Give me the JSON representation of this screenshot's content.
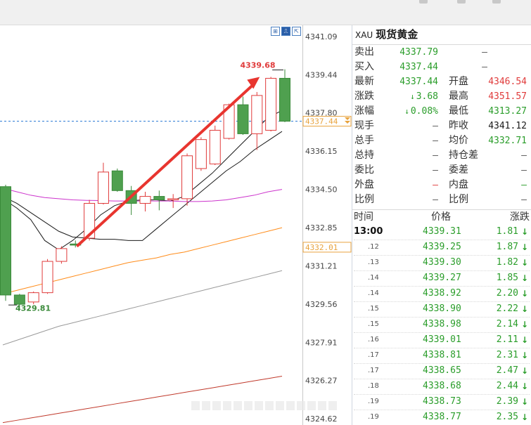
{
  "chart_data": {
    "type": "candlestick",
    "y_axis": {
      "range": [
        4323.94,
        4341.6
      ],
      "ticks": [
        "4341.09",
        "4339.44",
        "4337.80",
        "4336.15",
        "4334.50",
        "4332.85",
        "4331.21",
        "4329.56",
        "4327.91",
        "4326.27",
        "4324.62"
      ],
      "tick_values": [
        4341.09,
        4339.44,
        4337.8,
        4336.15,
        4334.5,
        4332.85,
        4331.21,
        4329.56,
        4327.91,
        4326.27,
        4324.62
      ]
    },
    "candles": [
      {
        "o": 4334.62,
        "c": 4329.95,
        "h": 4334.7,
        "l": 4329.7
      },
      {
        "o": 4329.95,
        "c": 4329.55,
        "h": 4330.0,
        "l": 4329.4
      },
      {
        "o": 4329.65,
        "c": 4330.05,
        "h": 4330.1,
        "l": 4329.55
      },
      {
        "o": 4330.05,
        "c": 4331.4,
        "h": 4331.5,
        "l": 4330.0
      },
      {
        "o": 4331.4,
        "c": 4331.95,
        "h": 4332.05,
        "l": 4331.3
      },
      {
        "o": 4332.15,
        "c": 4332.1,
        "h": 4332.3,
        "l": 4332.0
      },
      {
        "o": 4332.4,
        "c": 4333.9,
        "h": 4334.05,
        "l": 4332.3
      },
      {
        "o": 4333.9,
        "c": 4335.25,
        "h": 4335.65,
        "l": 4333.85
      },
      {
        "o": 4335.3,
        "c": 4334.45,
        "h": 4335.4,
        "l": 4334.4
      },
      {
        "o": 4334.45,
        "c": 4333.9,
        "h": 4334.65,
        "l": 4333.4
      },
      {
        "o": 4333.9,
        "c": 4334.2,
        "h": 4334.4,
        "l": 4333.55
      },
      {
        "o": 4334.2,
        "c": 4334.05,
        "h": 4334.45,
        "l": 4333.6
      },
      {
        "o": 4334.05,
        "c": 4334.1,
        "h": 4334.3,
        "l": 4333.7
      },
      {
        "o": 4334.1,
        "c": 4335.95,
        "h": 4336.05,
        "l": 4333.8
      },
      {
        "o": 4335.4,
        "c": 4336.65,
        "h": 4336.75,
        "l": 4335.3
      },
      {
        "o": 4335.6,
        "c": 4337.05,
        "h": 4337.25,
        "l": 4335.55
      },
      {
        "o": 4336.7,
        "c": 4338.15,
        "h": 4338.2,
        "l": 4336.65
      },
      {
        "o": 4338.15,
        "c": 4336.9,
        "h": 4338.5,
        "l": 4336.85
      },
      {
        "o": 4336.9,
        "c": 4338.55,
        "h": 4338.7,
        "l": 4336.2
      },
      {
        "o": 4337.05,
        "c": 4339.29,
        "h": 4339.35,
        "l": 4337.0
      },
      {
        "o": 4339.29,
        "c": 4337.44,
        "h": 4339.68,
        "l": 4337.4
      }
    ],
    "up_color": "#e03b3b",
    "down_color": "#4fa04f",
    "moving_averages": [
      {
        "color": "#1a1a1a",
        "values": [
          4334.1,
          4333.7,
          4333.2,
          4332.3,
          4331.9,
          4332.3,
          4332.8,
          4333.4,
          4333.8,
          4334.0,
          4334.05,
          4334.05,
          4334.0,
          4334.2,
          4334.7,
          4335.2,
          4335.8,
          4336.4,
          4337.0,
          4337.6,
          4337.9
        ]
      },
      {
        "color": "#1a1a1a",
        "values": [
          4334.2,
          4333.9,
          4333.5,
          4333.1,
          4332.7,
          4332.45,
          4332.4,
          4332.35,
          4332.35,
          4332.3,
          4332.3,
          4332.8,
          4333.3,
          4333.8,
          4334.3,
          4334.8,
          4335.3,
          4335.7,
          4336.2,
          4336.6,
          4337.0
        ]
      },
      {
        "color": "#cc33cc",
        "values": [
          4334.55,
          4334.4,
          4334.25,
          4334.15,
          4334.1,
          4334.05,
          4334.03,
          4334.02,
          4334.0,
          4334.0,
          4334.0,
          4334.0,
          4334.0,
          4333.98,
          4333.98,
          4334.0,
          4334.05,
          4334.15,
          4334.25,
          4334.4,
          4334.5
        ]
      },
      {
        "color": "#ff8c1a",
        "values": [
          4330.0,
          4330.15,
          4330.3,
          4330.45,
          4330.6,
          4330.75,
          4330.9,
          4331.05,
          4331.2,
          4331.35,
          4331.45,
          4331.55,
          4331.7,
          4331.8,
          4331.95,
          4332.1,
          4332.25,
          4332.4,
          4332.55,
          4332.7,
          4332.85
        ]
      },
      {
        "color": "#9a9a9a",
        "values": [
          4327.8,
          4328.0,
          4328.2,
          4328.4,
          4328.6,
          4328.75,
          4328.9,
          4329.05,
          4329.2,
          4329.35,
          4329.5,
          4329.65,
          4329.8,
          4329.95,
          4330.1,
          4330.25,
          4330.4,
          4330.55,
          4330.7,
          4330.85,
          4331.0
        ]
      },
      {
        "color": "#c0392b",
        "values": [
          4324.45,
          4324.55,
          4324.65,
          4324.75,
          4324.85,
          4324.95,
          4325.05,
          4325.15,
          4325.25,
          4325.35,
          4325.45,
          4325.55,
          4325.65,
          4325.75,
          4325.85,
          4325.95,
          4326.05,
          4326.15,
          4326.25,
          4326.35,
          4326.45
        ]
      }
    ],
    "annotations": {
      "high_label": "4339.68",
      "low_label": "4329.81",
      "arrow_color": "#e8352f"
    },
    "price_tags": [
      {
        "label": "4337.44",
        "value": 4337.44,
        "color": "#e8a33d"
      },
      {
        "label": "4332.01",
        "value": 4332.01,
        "color": "#e8a33d"
      }
    ],
    "current_price_line": 4337.44,
    "toolbar_icons": [
      "chart-mode-icon",
      "chart-bars-icon",
      "expand-icon"
    ]
  },
  "quote_panel": {
    "code": "XAU",
    "name": "现货黄金",
    "rows": [
      {
        "l1": "卖出",
        "v1": "4337.79",
        "c1": "green",
        "l2": "",
        "v2": "–",
        "c2": "gray"
      },
      {
        "l1": "买入",
        "v1": "4337.44",
        "c1": "green",
        "l2": "",
        "v2": "–",
        "c2": "gray"
      },
      {
        "l1": "最新",
        "v1": "4337.44",
        "c1": "green",
        "l2": "开盘",
        "v2": "4346.54",
        "c2": "red"
      },
      {
        "l1": "涨跌",
        "v1": "3.68",
        "c1": "green",
        "a1": "↓",
        "l2": "最高",
        "v2": "4351.57",
        "c2": "red"
      },
      {
        "l1": "涨幅",
        "v1": "0.08%",
        "c1": "green",
        "a1": "↓",
        "l2": "最低",
        "v2": "4313.27",
        "c2": "green"
      },
      {
        "l1": "现手",
        "v1": "–",
        "c1": "gray",
        "l2": "昨收",
        "v2": "4341.12",
        "c2": "dark"
      },
      {
        "l1": "总手",
        "v1": "–",
        "c1": "gray",
        "l2": "均价",
        "v2": "4332.71",
        "c2": "green"
      },
      {
        "l1": "总持",
        "v1": "–",
        "c1": "gray",
        "l2": "持仓差",
        "v2": "–",
        "c2": "gray"
      },
      {
        "l1": "委比",
        "v1": "–",
        "c1": "gray",
        "l2": "委差",
        "v2": "–",
        "c2": "gray"
      },
      {
        "l1": "外盘",
        "v1": "–",
        "c1": "red",
        "l2": "内盘",
        "v2": "–",
        "c2": "green"
      },
      {
        "l1": "比例",
        "v1": "–",
        "c1": "gray",
        "l2": "比例",
        "v2": "–",
        "c2": "gray"
      }
    ]
  },
  "trades": {
    "headers": [
      "时间",
      "价格",
      "涨跌"
    ],
    "rows": [
      {
        "t": "13:00",
        "p": "4339.31",
        "c": "1.81"
      },
      {
        "t": ".12",
        "p": "4339.25",
        "c": "1.87"
      },
      {
        "t": ".13",
        "p": "4339.30",
        "c": "1.82"
      },
      {
        "t": ".14",
        "p": "4339.27",
        "c": "1.85"
      },
      {
        "t": ".14",
        "p": "4338.92",
        "c": "2.20"
      },
      {
        "t": ".15",
        "p": "4338.90",
        "c": "2.22"
      },
      {
        "t": ".15",
        "p": "4338.98",
        "c": "2.14"
      },
      {
        "t": ".16",
        "p": "4339.01",
        "c": "2.11"
      },
      {
        "t": ".17",
        "p": "4338.81",
        "c": "2.31"
      },
      {
        "t": ".17",
        "p": "4338.65",
        "c": "2.47"
      },
      {
        "t": ".18",
        "p": "4338.68",
        "c": "2.44"
      },
      {
        "t": ".19",
        "p": "4338.73",
        "c": "2.39"
      },
      {
        "t": ".19",
        "p": "4338.77",
        "c": "2.35"
      }
    ]
  },
  "colors": {
    "green": "#2a9d2a",
    "red": "#e03b3b",
    "gray": "#555555",
    "dark": "#1a1a1a"
  }
}
